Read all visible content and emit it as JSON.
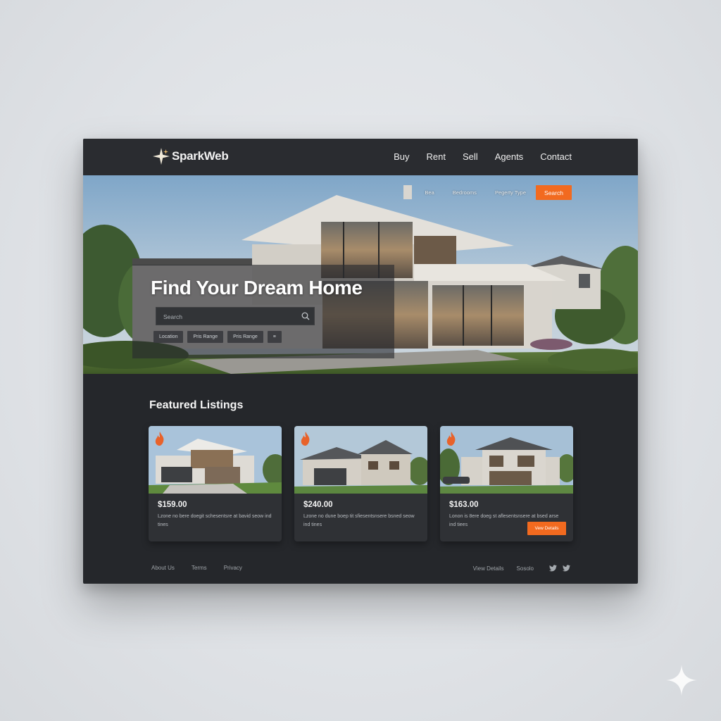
{
  "header": {
    "logo_text": "SparkWeb",
    "nav": [
      "Buy",
      "Rent",
      "Sell",
      "Agents",
      "Contact"
    ]
  },
  "hero": {
    "filters": [
      "Bea",
      "Bedrooms",
      "Pegerty Type"
    ],
    "filter_button": "Search",
    "title": "Find Your Dream Home",
    "search_placeholder": "Search",
    "chips": [
      "Location",
      "Pris Range",
      "Pris Range",
      "≡"
    ]
  },
  "featured": {
    "title": "Featured Listings",
    "cards": [
      {
        "price": "$159.00",
        "description": "Lzone no bere doegit schesentsre at bavid seow ind tines"
      },
      {
        "price": "$240.00",
        "description": "Lzone no dune boep tit sfiesentsnsere bsned seow ind tines"
      },
      {
        "price": "$163.00",
        "description": "Lonon is 8ere doeg st aflesentsnsere at bsed arse ind tiees",
        "button": "Vew Details"
      }
    ]
  },
  "footer": {
    "links": [
      "About Us",
      "Terms",
      "Privacy"
    ],
    "right_links": [
      "View Details",
      "Sosolo"
    ],
    "social_icons": [
      "twitter-icon",
      "twitter-icon"
    ]
  },
  "colors": {
    "accent": "#f26a1f",
    "background": "#25272b",
    "header": "#2a2c30"
  }
}
